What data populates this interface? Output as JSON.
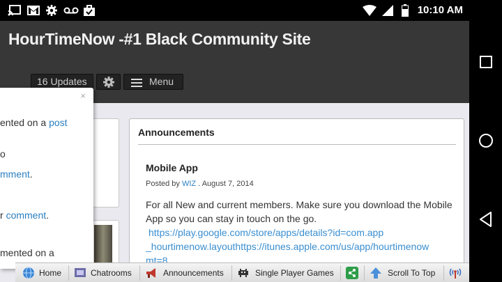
{
  "status_bar": {
    "time": "10:10 AM",
    "icons": [
      "cast-icon",
      "gmail-icon",
      "settings-gear-icon",
      "voicemail-icon",
      "briefcase-check-icon",
      "wifi-icon",
      "signal-icon",
      "battery-icon"
    ]
  },
  "site": {
    "title": "HourTimeNow -#1 Black Community Site"
  },
  "header_buttons": {
    "updates_label": "16 Updates",
    "menu_label": "Menu"
  },
  "popup": {
    "close_glyph": "×",
    "lines": [
      {
        "prefix": "ented on a ",
        "link": "post"
      },
      {
        "prefix": "o",
        "link": ""
      },
      {
        "prefix": "",
        "link": "mment",
        "suffix": "."
      },
      {
        "prefix": "r ",
        "link": "comment",
        "suffix": "."
      },
      {
        "prefix": "mented on a",
        "link": ""
      }
    ]
  },
  "announcements": {
    "heading": "Announcements",
    "post": {
      "title": "Mobile App",
      "posted_by_label": "Posted by",
      "author": "WIZ",
      "date": ". August 7, 2014",
      "body": "For all New and current members. Make sure you download the Mobile App so you can stay in touch on the go.",
      "link_line1": "https://play.google.com/store/apps/details?id=com.app",
      "link_line2": "_hourtimenow.layouthttps://itunes.apple.com/us/app/hourtimenow",
      "link_line3": "mt=8"
    }
  },
  "bottom_bar": {
    "items": [
      {
        "label": "Home",
        "icon": "globe-icon"
      },
      {
        "label": "Chatrooms",
        "icon": "chat-icon"
      },
      {
        "label": "Announcements",
        "icon": "megaphone-icon"
      },
      {
        "label": "Single Player Games",
        "icon": "space-invader-icon"
      },
      {
        "label": "",
        "icon": "share-icon"
      },
      {
        "label": "Scroll To Top",
        "icon": "up-arrow-icon"
      },
      {
        "label": "",
        "icon": "antenna-icon"
      }
    ]
  },
  "nav_bar": {
    "buttons": [
      "recents-button",
      "home-button",
      "back-button"
    ]
  }
}
